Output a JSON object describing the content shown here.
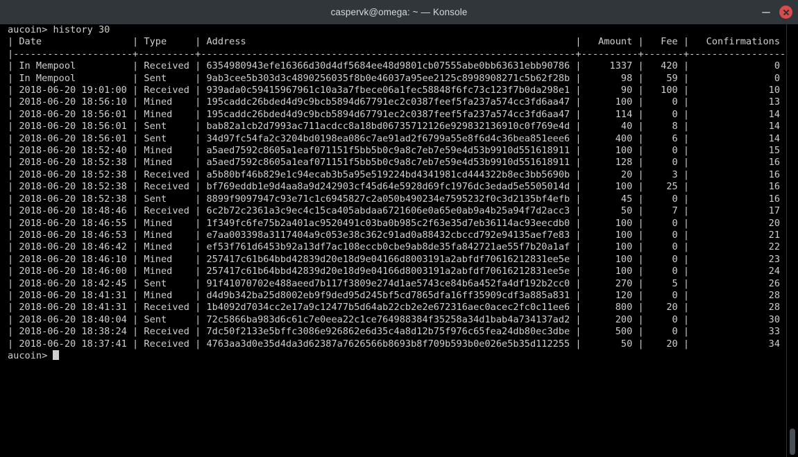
{
  "window": {
    "title": "caspervk@omega: ~ — Konsole",
    "minimize_label": "Minimize",
    "close_label": "Close"
  },
  "terminal": {
    "prompt": "aucoin>",
    "command": "history 30",
    "command_line": "aucoin> history 30",
    "final_prompt": "aucoin>",
    "columns": [
      "Date",
      "Type",
      "Address",
      "Amount",
      "Fee",
      "Confirmations"
    ],
    "header_line": "| Date                | Type     | Address                                                          |   Amount |   Fee |   Confirmations |",
    "separator_line": "|---------------------+----------+------------------------------------------------------------------+----------+-------+-----------------|",
    "rows": [
      {
        "date": "In Mempool",
        "type": "Received",
        "address": "6354980943efe16366d30d4df5684ee48d9801cb07555abe0bb63631ebb90786",
        "amount": "1337",
        "fee": "420",
        "confirmations": "0"
      },
      {
        "date": "In Mempool",
        "type": "Sent",
        "address": "9ab3cee5b303d3c4890256035f8b0e46037a95ee2125c8998908271c5b62f28b",
        "amount": "98",
        "fee": "59",
        "confirmations": "0"
      },
      {
        "date": "2018-06-20 19:01:00",
        "type": "Received",
        "address": "939ada0c59415967961c10a3a7fbece06a1fec58848f6fc73c123f7b0da298e1",
        "amount": "90",
        "fee": "100",
        "confirmations": "10"
      },
      {
        "date": "2018-06-20 18:56:10",
        "type": "Mined",
        "address": "195caddc26bded4d9c9bcb5894d67791ec2c0387feef5fa237a574cc3fd6aa47",
        "amount": "100",
        "fee": "0",
        "confirmations": "13"
      },
      {
        "date": "2018-06-20 18:56:01",
        "type": "Mined",
        "address": "195caddc26bded4d9c9bcb5894d67791ec2c0387feef5fa237a574cc3fd6aa47",
        "amount": "114",
        "fee": "0",
        "confirmations": "14"
      },
      {
        "date": "2018-06-20 18:56:01",
        "type": "Sent",
        "address": "bab82a1cb2d7993ac711acdcc8a18bd06735712126e929832136910c0f769e4d",
        "amount": "40",
        "fee": "8",
        "confirmations": "14"
      },
      {
        "date": "2018-06-20 18:56:01",
        "type": "Sent",
        "address": "34d97fc54fa2c3204bd0198ea086c7ae91ad2f6799a55e8f6d4c36bea851eee6",
        "amount": "400",
        "fee": "6",
        "confirmations": "14"
      },
      {
        "date": "2018-06-20 18:52:40",
        "type": "Mined",
        "address": "a5aed7592c8605a1eaf071151f5bb5b0c9a8c7eb7e59e4d53b9910d551618911",
        "amount": "100",
        "fee": "0",
        "confirmations": "15"
      },
      {
        "date": "2018-06-20 18:52:38",
        "type": "Mined",
        "address": "a5aed7592c8605a1eaf071151f5bb5b0c9a8c7eb7e59e4d53b9910d551618911",
        "amount": "128",
        "fee": "0",
        "confirmations": "16"
      },
      {
        "date": "2018-06-20 18:52:38",
        "type": "Received",
        "address": "a5b80bf46b829e1c94ecab3b5a95e519224bd4341981cd444322b8ec3bb5690b",
        "amount": "20",
        "fee": "3",
        "confirmations": "16"
      },
      {
        "date": "2018-06-20 18:52:38",
        "type": "Received",
        "address": "bf769eddb1e9d4aa8a9d242903cf45d64e5928d69fc1976dc3edad5e5505014d",
        "amount": "100",
        "fee": "25",
        "confirmations": "16"
      },
      {
        "date": "2018-06-20 18:52:38",
        "type": "Sent",
        "address": "8899f9097947c93e71c1c6945827c2a050b490234e7595232f0c3d2135bf4efb",
        "amount": "45",
        "fee": "0",
        "confirmations": "16"
      },
      {
        "date": "2018-06-20 18:48:46",
        "type": "Received",
        "address": "6c2b72c2361a3c9ec4c15ca405abdaa6721606e0a65e0ab9a4b25a94f7d2acc3",
        "amount": "50",
        "fee": "7",
        "confirmations": "17"
      },
      {
        "date": "2018-06-20 18:46:55",
        "type": "Mined",
        "address": "1f349fc6fe75b2a401ac9520491c03ba0b985c2f63e35d7eb36114ac93eecdb0",
        "amount": "100",
        "fee": "0",
        "confirmations": "20"
      },
      {
        "date": "2018-06-20 18:46:53",
        "type": "Mined",
        "address": "e7aa003398a3117404a9c053e38c362c91ad0a88432cbccd792e94135aef7e83",
        "amount": "100",
        "fee": "0",
        "confirmations": "21"
      },
      {
        "date": "2018-06-20 18:46:42",
        "type": "Mined",
        "address": "ef53f761d6453b92a13df7ac108eccb0cbe9ab8de35fa842721ae55f7b20a1af",
        "amount": "100",
        "fee": "0",
        "confirmations": "22"
      },
      {
        "date": "2018-06-20 18:46:10",
        "type": "Mined",
        "address": "257417c61b64bbd42839d20e18d9e04166d8003191a2abfdf70616212831ee5e",
        "amount": "100",
        "fee": "0",
        "confirmations": "23"
      },
      {
        "date": "2018-06-20 18:46:00",
        "type": "Mined",
        "address": "257417c61b64bbd42839d20e18d9e04166d8003191a2abfdf70616212831ee5e",
        "amount": "100",
        "fee": "0",
        "confirmations": "24"
      },
      {
        "date": "2018-06-20 18:42:45",
        "type": "Sent",
        "address": "91f41070702e488aeed7b117f3809e274d1ae5743ce84b6a452fa4df192b2cc0",
        "amount": "270",
        "fee": "5",
        "confirmations": "26"
      },
      {
        "date": "2018-06-20 18:41:31",
        "type": "Mined",
        "address": "d4d9b342ba25d8002eb9f9ded95d245bf5cd7865dfa16ff35909cdf3a885a831",
        "amount": "120",
        "fee": "0",
        "confirmations": "28"
      },
      {
        "date": "2018-06-20 18:41:31",
        "type": "Received",
        "address": "1b4092d7034cc2e17a9c12477b5d64ab22cb2e2e672316aec0acec2fc0c11ee6",
        "amount": "800",
        "fee": "20",
        "confirmations": "28"
      },
      {
        "date": "2018-06-20 18:40:04",
        "type": "Sent",
        "address": "72c5866ba983d6c61c7e0eea22c1ce764988384f35258a34d1bab4a734137ad2",
        "amount": "200",
        "fee": "0",
        "confirmations": "30"
      },
      {
        "date": "2018-06-20 18:38:24",
        "type": "Received",
        "address": "7dc50f2133e5bffc3086e926862e6d35c4a8d12b75f976c65fea24db80ec3dbe",
        "amount": "500",
        "fee": "0",
        "confirmations": "33"
      },
      {
        "date": "2018-06-20 18:37:41",
        "type": "Received",
        "address": "4763aa3d0e35d4da3d62387a7626566b8693b8f709b593b0e026e5b35d112255",
        "amount": "50",
        "fee": "20",
        "confirmations": "34"
      }
    ]
  },
  "colors": {
    "titlebar_bg": "#31363b",
    "terminal_bg": "#000000",
    "text": "#cfd0cd",
    "close_button": "#d94a4a"
  }
}
